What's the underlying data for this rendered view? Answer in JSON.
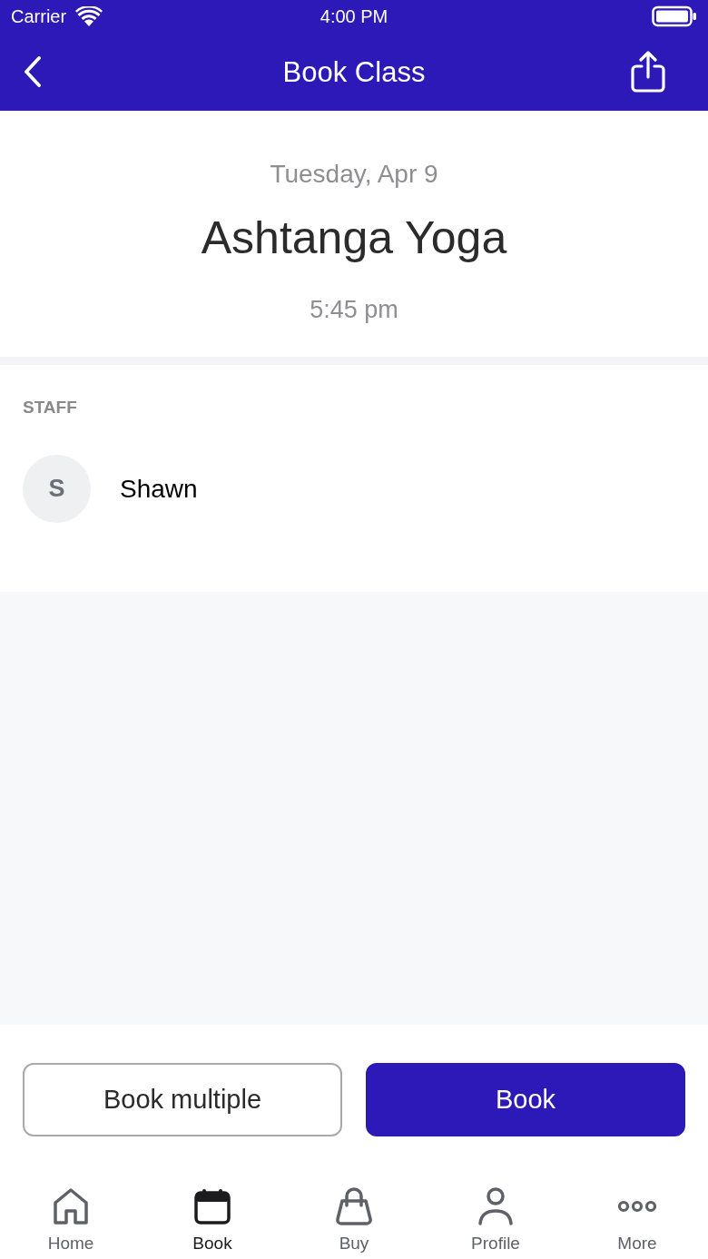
{
  "status_bar": {
    "carrier": "Carrier",
    "time": "4:00 PM"
  },
  "nav_bar": {
    "title": "Book Class"
  },
  "class_header": {
    "date": "Tuesday, Apr 9",
    "name": "Ashtanga Yoga",
    "time": "5:45 pm"
  },
  "staff": {
    "heading": "STAFF",
    "members": [
      {
        "initial": "S",
        "name": "Shawn"
      }
    ]
  },
  "actions": [
    {
      "label": "Book multiple",
      "kind": "outline"
    },
    {
      "label": "Book",
      "kind": "primary"
    }
  ],
  "tab_bar": [
    {
      "label": "Home",
      "kind": "home",
      "selected": false
    },
    {
      "label": "Book",
      "kind": "calendar",
      "selected": true
    },
    {
      "label": "Buy",
      "kind": "bag",
      "selected": false
    },
    {
      "label": "Profile",
      "kind": "person",
      "selected": false
    },
    {
      "label": "More",
      "kind": "more",
      "selected": false
    }
  ]
}
